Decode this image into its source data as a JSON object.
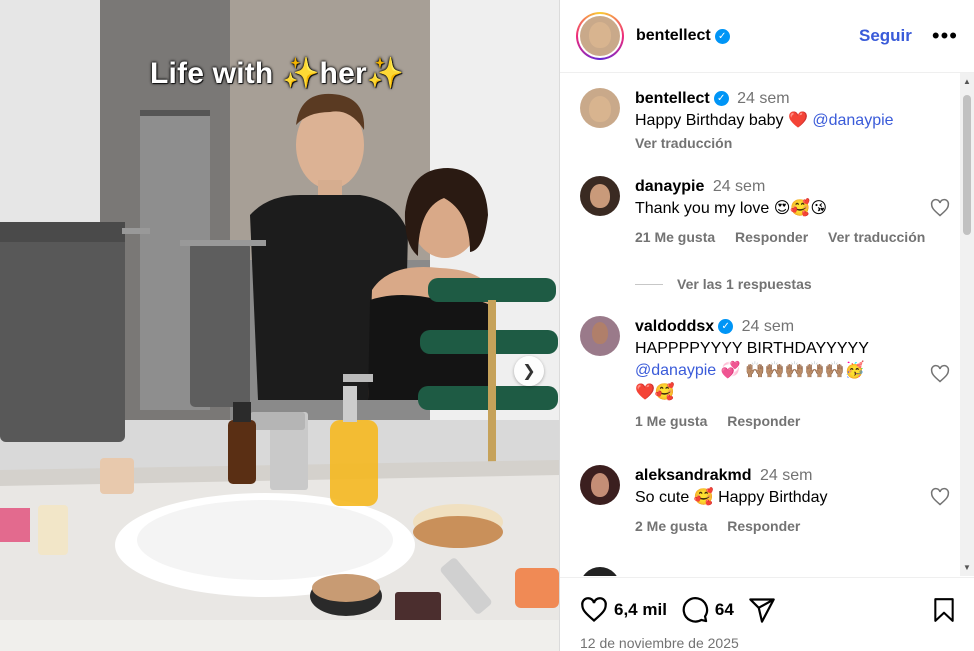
{
  "media": {
    "overlay_text": "Life with ✨her✨",
    "next_icon": "chevron-right-icon"
  },
  "header": {
    "username": "bentellect",
    "verified": true,
    "follow_label": "Seguir",
    "more_label": "•••"
  },
  "caption": {
    "username": "bentellect",
    "time": "24 sem",
    "text": "Happy Birthday baby",
    "emoji": "❤️",
    "mention": "@danaypie",
    "translate_label": "Ver traducción"
  },
  "comments": [
    {
      "username": "danaypie",
      "time": "24 sem",
      "text": "Thank you my love 😍🥰😘",
      "likes": "21 Me gusta",
      "reply_label": "Responder",
      "translate_label": "Ver traducción"
    },
    {
      "username": "valdoddsx",
      "verified": true,
      "time": "24 sem",
      "text_line1": "HAPPPPYYYY BIRTHDAYYYYY",
      "mention": "@danaypie",
      "text_line2_emoji": "💞 🙌🏽🙌🏽🙌🏽🙌🏽🙌🏽🥳",
      "text_line3_emoji": "❤️🥰",
      "likes": "1 Me gusta",
      "reply_label": "Responder"
    },
    {
      "username": "aleksandrakmd",
      "time": "24 sem",
      "text": "So cute 🥰 Happy Birthday",
      "likes": "2 Me gusta",
      "reply_label": "Responder"
    }
  ],
  "view_replies_label": "Ver las 1 respuestas",
  "actions": {
    "likes_count": "6,4 mil",
    "comments_count": "64"
  },
  "date": "12 de noviembre de 2025",
  "colors": {
    "link": "#3a5bd9",
    "muted": "#737373",
    "verified": "#0095f6"
  }
}
